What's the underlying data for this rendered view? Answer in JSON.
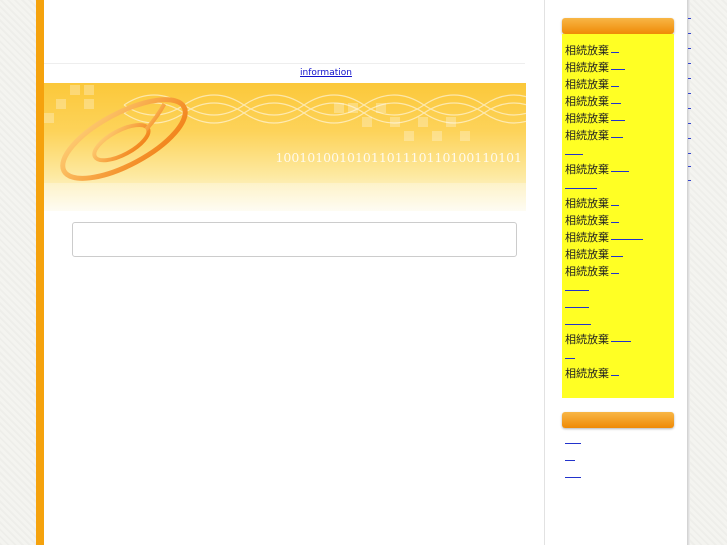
{
  "nav": {
    "information": "information"
  },
  "banner": {
    "binary_text": "1001010010101101110110100110101"
  },
  "sidebar1": {
    "items": [
      {
        "label": "相続放棄",
        "dash": 8
      },
      {
        "label": "相続放棄",
        "dash": 14
      },
      {
        "label": "相続放棄",
        "dash": 8
      },
      {
        "label": "相続放棄",
        "dash": 10
      },
      {
        "label": "相続放棄",
        "dash": 14
      },
      {
        "label": "相続放棄",
        "dash": 12
      },
      {
        "label": "",
        "dash": 18
      },
      {
        "label": "相続放棄",
        "dash": 18
      },
      {
        "label": "",
        "dash": 32
      },
      {
        "label": "相続放棄",
        "dash": 8
      },
      {
        "label": "相続放棄",
        "dash": 8
      },
      {
        "label": "相続放棄",
        "dash": 32
      },
      {
        "label": "相続放棄",
        "dash": 12
      },
      {
        "label": "相続放棄",
        "dash": 8
      },
      {
        "label": "",
        "dash": 24
      },
      {
        "label": "",
        "dash": 24
      },
      {
        "label": "",
        "dash": 26
      },
      {
        "label": "相続放棄",
        "dash": 20
      },
      {
        "label": "",
        "dash": 10
      },
      {
        "label": "相続放棄",
        "dash": 8
      }
    ]
  },
  "sidebar2": {
    "links": [
      {
        "dash": 16
      },
      {
        "dash": 10
      },
      {
        "dash": 16
      }
    ]
  }
}
